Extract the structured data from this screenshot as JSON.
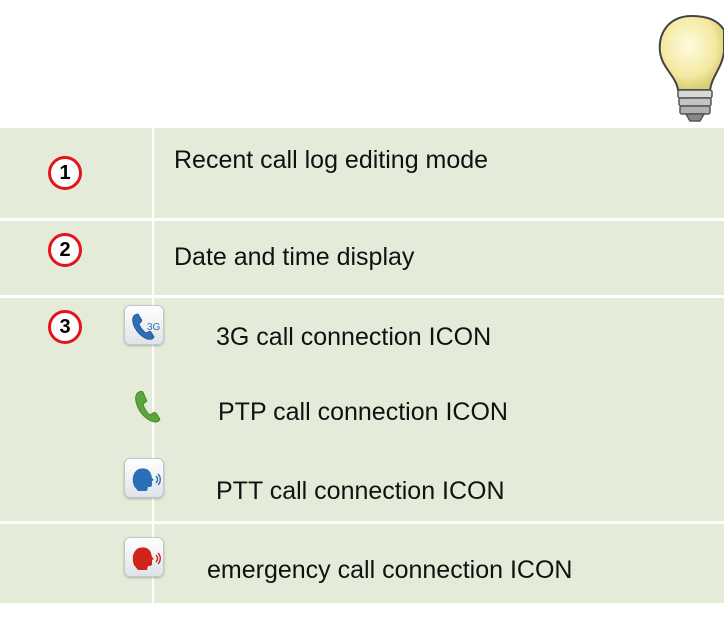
{
  "rows": [
    {
      "number": "1",
      "label": "Recent call log editing mode"
    },
    {
      "number": "2",
      "label": "Date and time display"
    },
    {
      "number": "3",
      "label": "3G call connection ICON",
      "icon": "phone-3g-icon"
    },
    {
      "label": "PTP call connection ICON",
      "icon": "phone-green-icon"
    },
    {
      "label": "PTT call connection ICON",
      "icon": "talk-blue-icon"
    },
    {
      "label": "emergency call connection ICON",
      "icon": "talk-red-icon"
    }
  ],
  "icon_badge_text": "3G",
  "colors": {
    "table_bg": "#e4ecd9",
    "number_ring": "#e3141a",
    "ptp_green": "#5aa63c",
    "ptt_blue": "#2a6fb8",
    "emergency_red": "#d0231a"
  }
}
